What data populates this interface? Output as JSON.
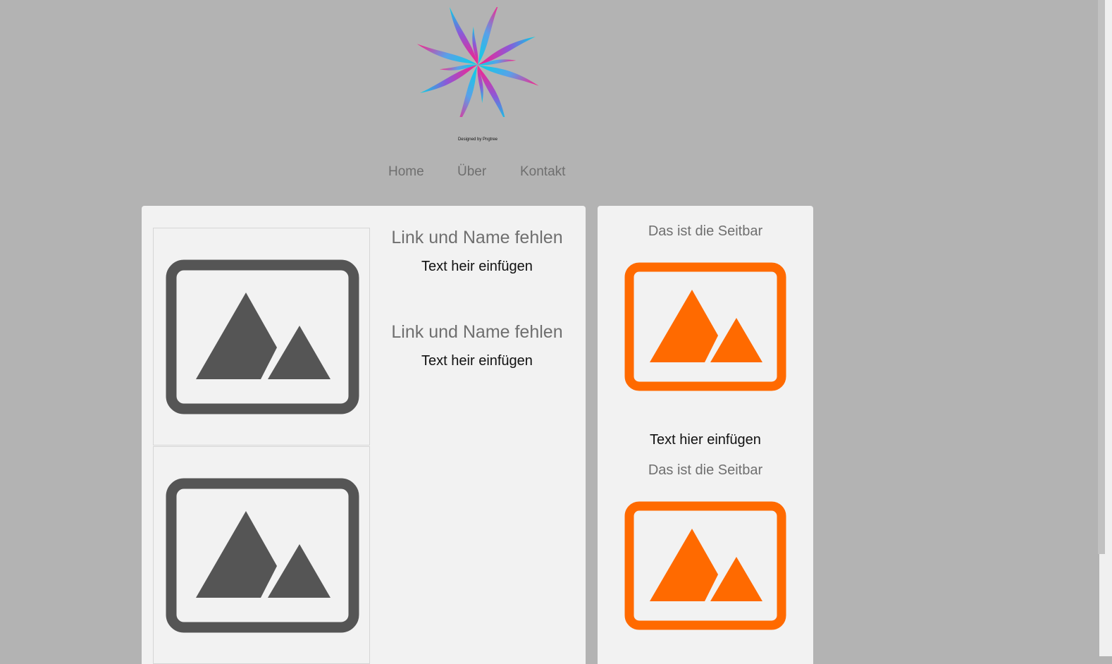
{
  "header": {
    "credit": "Designed by Pngtree"
  },
  "nav": {
    "items": [
      {
        "label": "Home"
      },
      {
        "label": "Über"
      },
      {
        "label": "Kontakt"
      }
    ]
  },
  "main": {
    "articles": [
      {
        "title": "Link und Name fehlen",
        "text": "Text heir einfügen"
      },
      {
        "title": "Link und Name fehlen",
        "text": "Text heir einfügen"
      }
    ]
  },
  "sidebar": {
    "blocks": [
      {
        "title": "Das ist die Seitbar",
        "text": "Text hier einfügen"
      },
      {
        "title": "Das ist die Seitbar"
      }
    ]
  },
  "colors": {
    "background": "#b3b3b3",
    "panel": "#f2f2f2",
    "placeholder_gray": "#555555",
    "accent_orange": "#ff6a00",
    "nav_text": "#6f6f6f"
  }
}
